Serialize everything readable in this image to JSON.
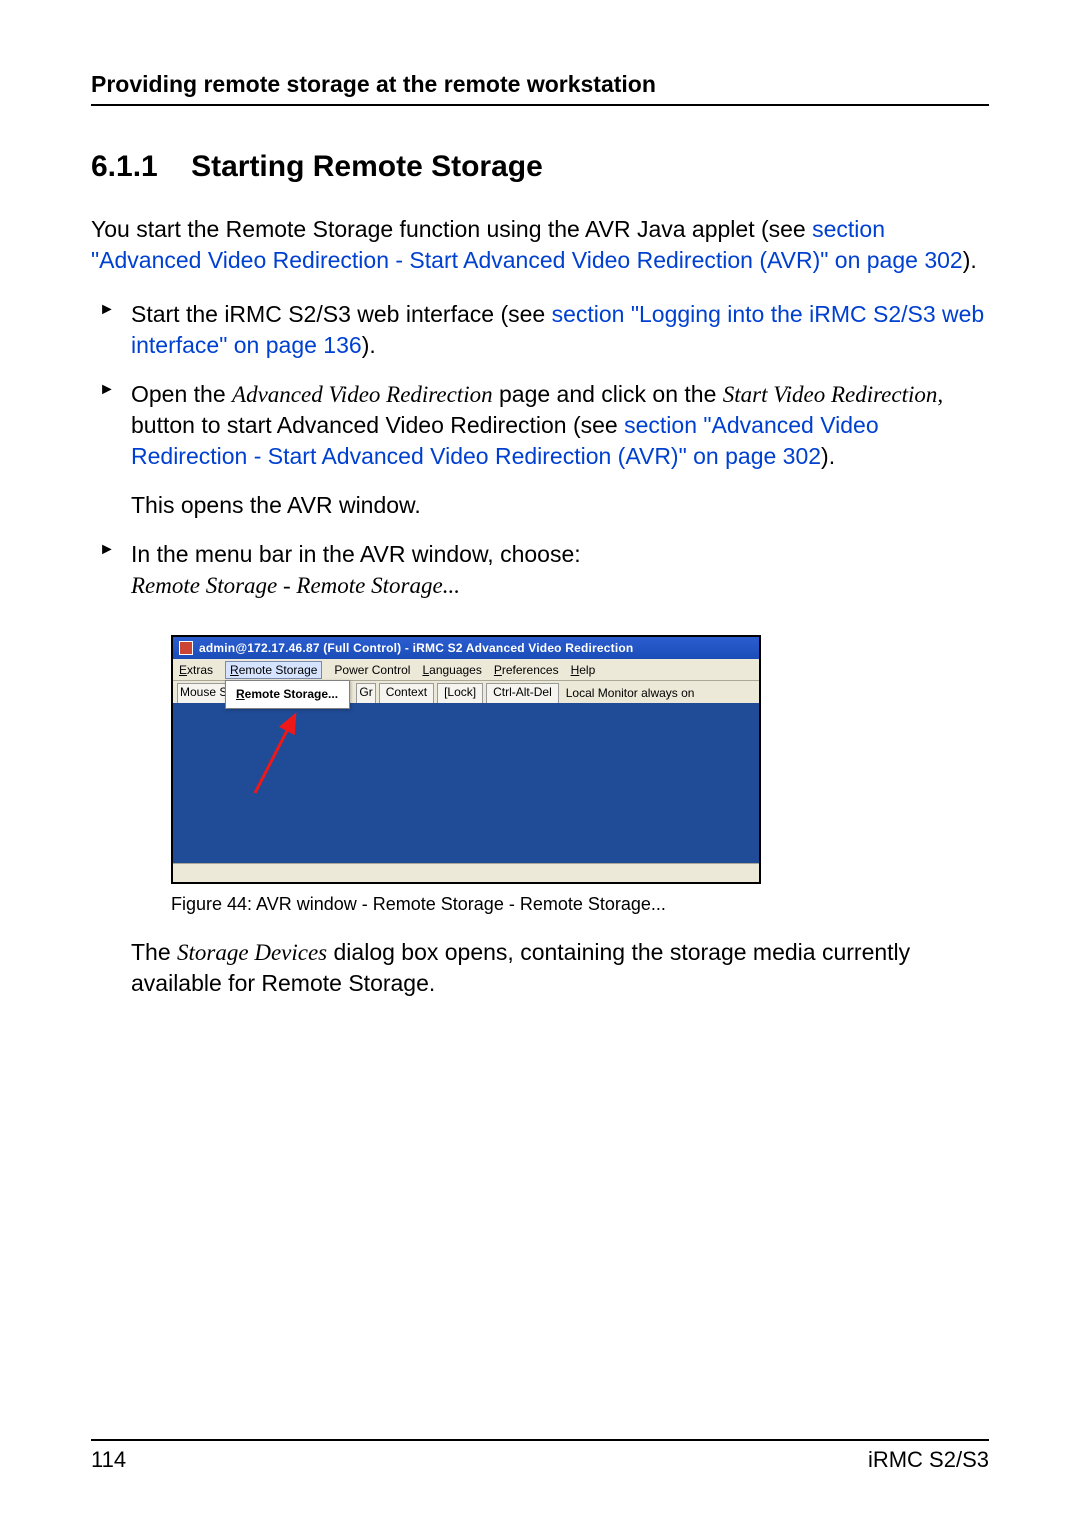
{
  "runningHead": "Providing remote storage at the remote workstation",
  "section": {
    "num": "6.1.1",
    "title": "Starting Remote Storage"
  },
  "intro": {
    "t1": "You start the Remote Storage function using the AVR Java applet (see ",
    "link1": "section \"Advanced Video Redirection - Start Advanced Video Redirection (AVR)\" on page 302",
    "t2": ")."
  },
  "steps": {
    "s1": {
      "t1": "Start the iRMC S2/S3 web interface (see ",
      "link": "section \"Logging into the iRMC S2/S3 web interface\" on page 136",
      "t2": ")."
    },
    "s2": {
      "t1": "Open the ",
      "i1": "Advanced Video Redirection",
      "t2": " page and click on the ",
      "i2": "Start Video Redirection,",
      "t3": " button to start Advanced Video Redirection (see ",
      "link": "section \"Advanced Video Redirection - Start Advanced Video Redirection (AVR)\" on page 302",
      "t4": ").",
      "after": "This opens the AVR window."
    },
    "s3": {
      "t1": "In the menu bar in the AVR window, choose:",
      "i1": "Remote Storage - Remote Storage..."
    }
  },
  "avr": {
    "title": "admin@172.17.46.87 (Full Control) - iRMC S2 Advanced Video Redirection",
    "menu": {
      "extras": "Extras",
      "remoteStorage": "Remote Storage",
      "powerControl": "Power Control",
      "languages": "Languages",
      "preferences": "Preferences",
      "help": "Help"
    },
    "toolbar": {
      "mouseSync": "Mouse S",
      "gr": "Gr",
      "context": "Context",
      "lock": "[Lock]",
      "cad": "Ctrl-Alt-Del",
      "monitor": "Local Monitor always on"
    },
    "dropdownItem": "Remote Storage..."
  },
  "figCaption": "Figure 44: AVR window - Remote Storage - Remote Storage...",
  "closing": {
    "t1": "The ",
    "i1": "Storage Devices",
    "t2": " dialog box opens, containing the storage media currently available for Remote Storage."
  },
  "footer": {
    "page": "114",
    "doc": "iRMC S2/S3"
  }
}
